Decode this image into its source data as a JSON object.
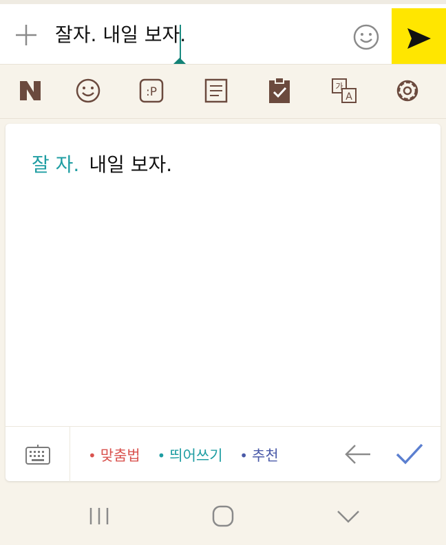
{
  "input_bar": {
    "message_text": "잘자. 내일 보자.",
    "plus_icon": "plus-icon",
    "emoji_icon": "smiley-icon",
    "send_icon": "send-arrow-icon",
    "send_color": "#ffe600"
  },
  "toolbar": {
    "items": [
      {
        "name": "naver-logo-icon",
        "glyph": "N"
      },
      {
        "name": "emoticon-icon"
      },
      {
        "name": "sticker-icon",
        "glyph": ":P"
      },
      {
        "name": "memo-icon"
      },
      {
        "name": "clipboard-check-icon"
      },
      {
        "name": "translate-icon",
        "glyph_top": "가",
        "glyph_bottom": "A"
      },
      {
        "name": "settings-gear-icon"
      }
    ]
  },
  "spell_check": {
    "corrected": "잘 자.",
    "rest": "내일 보자.",
    "legend": [
      {
        "label": "맞춤법",
        "color": "#d9534f"
      },
      {
        "label": "띄어쓰기",
        "color": "#1e9da2"
      },
      {
        "label": "추천",
        "color": "#4a5aa8"
      }
    ],
    "accent_color": "#1e9da2",
    "check_color": "#5b7fd0"
  },
  "navbar": {
    "items": [
      "recent-apps-icon",
      "home-icon",
      "back-chevron-icon"
    ]
  }
}
